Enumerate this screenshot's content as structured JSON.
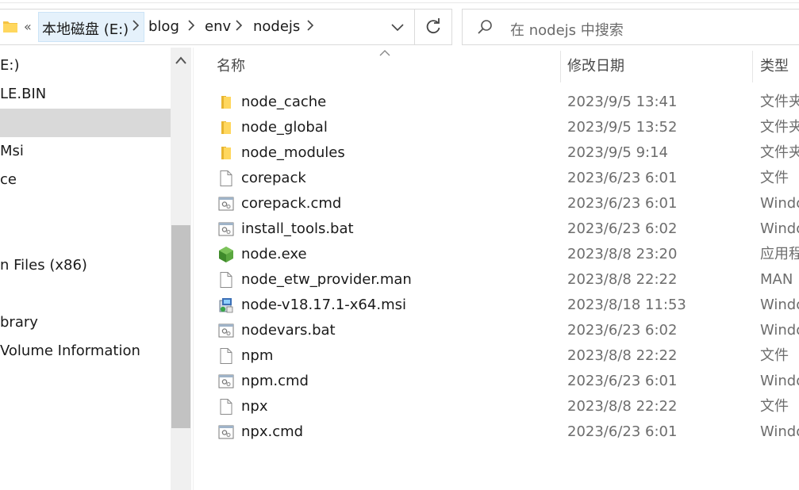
{
  "address_bar": {
    "overflow": "«",
    "crumbs": [
      "本地磁盘 (E:)",
      "blog",
      "env",
      "nodejs"
    ]
  },
  "search": {
    "placeholder": "在 nodejs 中搜索"
  },
  "nav_pane": {
    "items": [
      "E:)",
      "LE.BIN",
      "",
      "Msi",
      "ce",
      "",
      "",
      "n Files (x86)",
      "",
      "brary",
      "Volume Information"
    ],
    "selected_index": 2
  },
  "columns": {
    "name": "名称",
    "date": "修改日期",
    "type": "类型"
  },
  "files": [
    {
      "icon": "folder-icon",
      "name": "node_cache",
      "date": "2023/9/5 13:41",
      "type": "文件夹"
    },
    {
      "icon": "folder-icon",
      "name": "node_global",
      "date": "2023/9/5 13:52",
      "type": "文件夹"
    },
    {
      "icon": "folder-icon",
      "name": "node_modules",
      "date": "2023/9/5 9:14",
      "type": "文件夹"
    },
    {
      "icon": "file-icon",
      "name": "corepack",
      "date": "2023/6/23 6:01",
      "type": "文件"
    },
    {
      "icon": "batch-file-icon",
      "name": "corepack.cmd",
      "date": "2023/6/23 6:01",
      "type": "Windo"
    },
    {
      "icon": "batch-file-icon",
      "name": "install_tools.bat",
      "date": "2023/6/23 6:02",
      "type": "Windo"
    },
    {
      "icon": "node-exe-icon",
      "name": "node.exe",
      "date": "2023/8/8 23:20",
      "type": "应用程"
    },
    {
      "icon": "file-icon",
      "name": "node_etw_provider.man",
      "date": "2023/8/8 22:22",
      "type": "MAN"
    },
    {
      "icon": "msi-installer-icon",
      "name": "node-v18.17.1-x64.msi",
      "date": "2023/8/18 11:53",
      "type": "Windo"
    },
    {
      "icon": "batch-file-icon",
      "name": "nodevars.bat",
      "date": "2023/6/23 6:02",
      "type": "Windo"
    },
    {
      "icon": "file-icon",
      "name": "npm",
      "date": "2023/8/8 22:22",
      "type": "文件"
    },
    {
      "icon": "batch-file-icon",
      "name": "npm.cmd",
      "date": "2023/6/23 6:01",
      "type": "Windo"
    },
    {
      "icon": "file-icon",
      "name": "npx",
      "date": "2023/8/8 22:22",
      "type": "文件"
    },
    {
      "icon": "batch-file-icon",
      "name": "npx.cmd",
      "date": "2023/6/23 6:01",
      "type": "Windo"
    }
  ]
}
